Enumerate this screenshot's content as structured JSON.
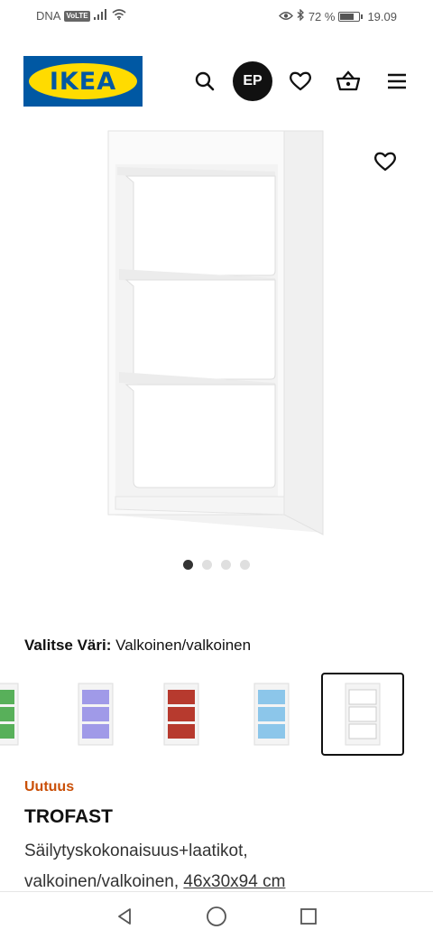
{
  "status_bar": {
    "carrier": "DNA",
    "volte": "VoLTE",
    "battery": "72 %",
    "battery_level": 0.72,
    "time": "19.09"
  },
  "header": {
    "logo_text": "IKEA",
    "avatar_initials": "EP",
    "icons": [
      "search-icon",
      "heart-icon",
      "basket-icon",
      "menu-icon"
    ]
  },
  "gallery": {
    "image_count": 4,
    "active_index": 0
  },
  "color": {
    "label": "Valitse Väri:",
    "value": "Valkoinen/valkoinen",
    "swatches": [
      {
        "name": "green",
        "color": "#58b05a"
      },
      {
        "name": "lilac",
        "color": "#a09ae8"
      },
      {
        "name": "red",
        "color": "#b73a2e"
      },
      {
        "name": "light-blue",
        "color": "#8cc6ea"
      },
      {
        "name": "white",
        "color": "#ffffff",
        "selected": true
      }
    ]
  },
  "product": {
    "badge": "Uutuus",
    "name": "TROFAST",
    "description_line1": "Säilytyskokonaisuus+laatikot,",
    "description_line2_prefix": "valkoinen/valkoinen, ",
    "dimensions": "46x30x94 cm"
  },
  "colors": {
    "brand_blue": "#0058a3",
    "brand_yellow": "#ffdb00",
    "badge_orange": "#ca5008"
  }
}
